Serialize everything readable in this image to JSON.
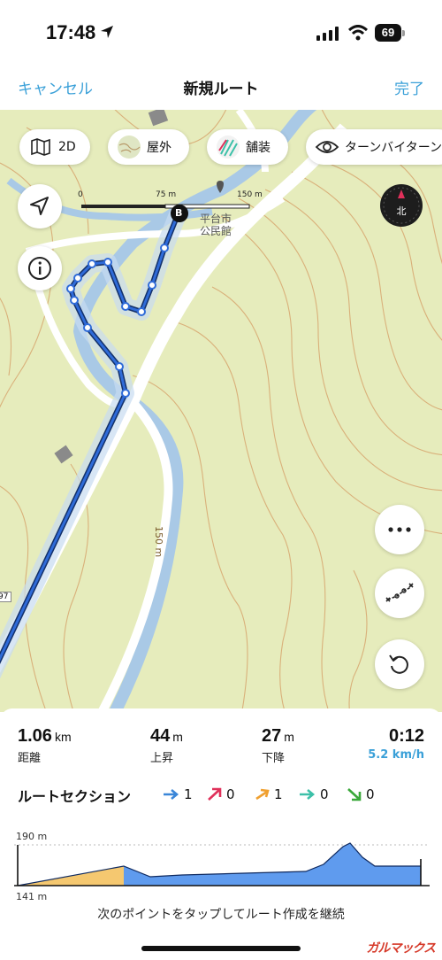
{
  "status": {
    "time": "17:48",
    "battery": "69"
  },
  "nav": {
    "cancel": "キャンセル",
    "title": "新規ルート",
    "done": "完了"
  },
  "map": {
    "chips": {
      "view": "2D",
      "outdoor": "屋外",
      "paved": "舗装",
      "turn": "ターンバイターン"
    },
    "scale": {
      "zero": "0",
      "mid": "75 m",
      "end": "150 m"
    },
    "poi": "平台市\n公民館",
    "end_marker": "B",
    "compass": "北",
    "road_number": "97",
    "distance_marker": "150 m"
  },
  "stats": {
    "distance": {
      "value": "1.06",
      "unit": "km",
      "label": "距離"
    },
    "ascent": {
      "value": "44",
      "unit": "m",
      "label": "上昇"
    },
    "descent": {
      "value": "27",
      "unit": "m",
      "label": "下降"
    },
    "duration": {
      "value": "0:12",
      "speed": "5.2 km/h"
    }
  },
  "sections": {
    "title": "ルートセクション",
    "items": [
      {
        "icon": "arrow-right-icon",
        "color": "#3a86d8",
        "count": "1"
      },
      {
        "icon": "arrow-up-right-icon",
        "color": "#e0305a",
        "count": "0"
      },
      {
        "icon": "arrow-up-right-icon",
        "color": "#f0a030",
        "count": "1"
      },
      {
        "icon": "arrow-right-icon",
        "color": "#3cc0a8",
        "count": "0"
      },
      {
        "icon": "arrow-down-right-icon",
        "color": "#3aa83a",
        "count": "0"
      }
    ]
  },
  "profile": {
    "max_label": "190 m",
    "min_label": "141 m"
  },
  "footer": "次のポイントをタップしてルート作成を継続",
  "watermark": "ガルマックス"
}
